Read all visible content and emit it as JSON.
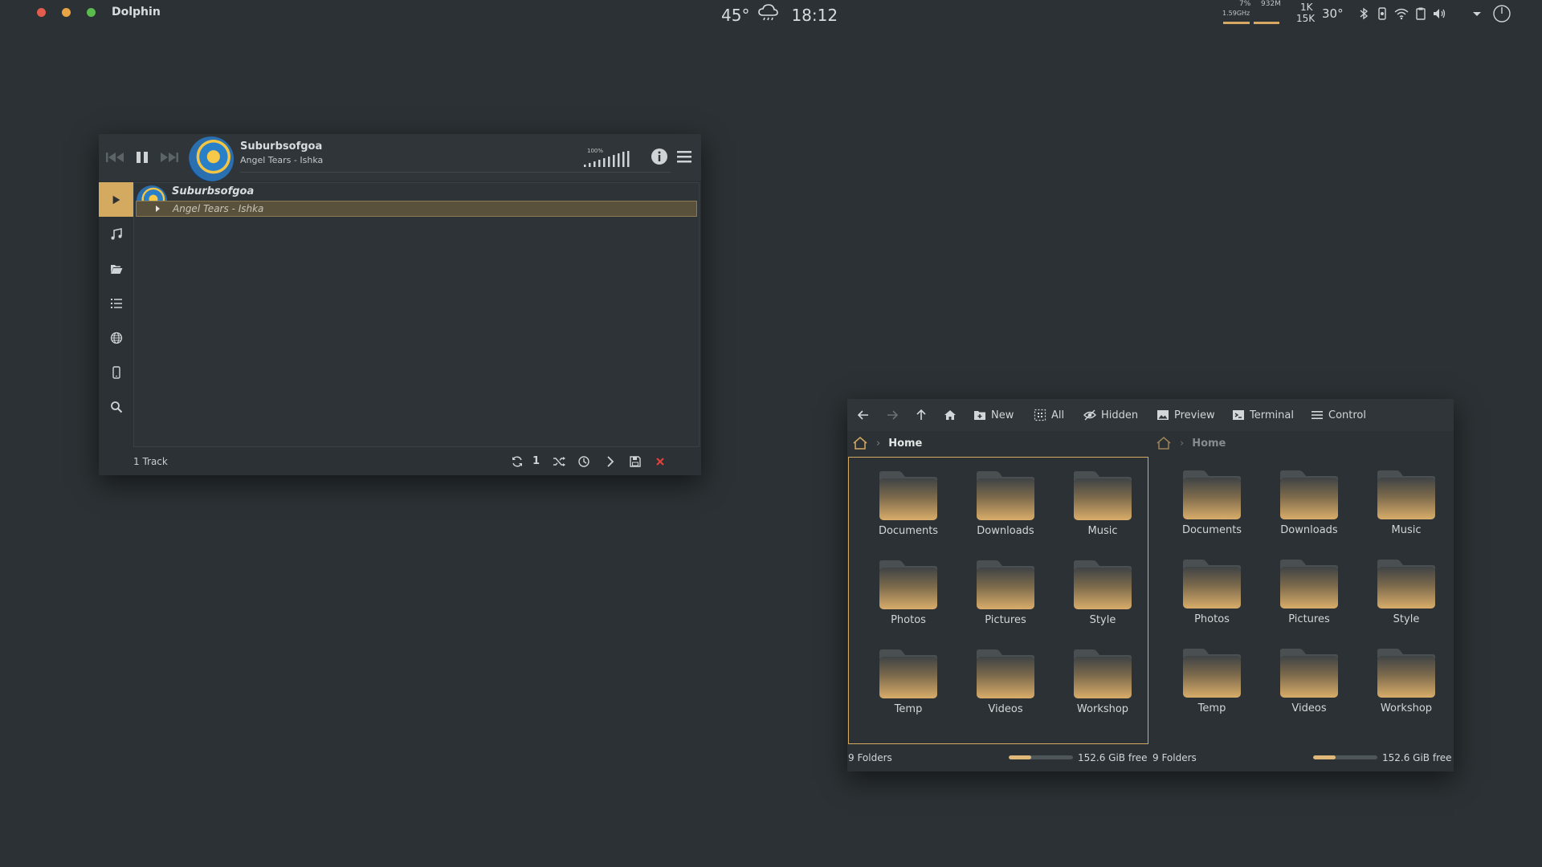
{
  "panel": {
    "app_name": "Dolphin",
    "weather_temp": "45°",
    "time": "18:12",
    "cpu_pct": "7%",
    "cpu_freq": "1.59GHz",
    "mem": "932M",
    "net_up": "1K",
    "net_down": "15K",
    "cpu_temp": "30°",
    "dot_colors": [
      "#e25d4d",
      "#e9a544",
      "#5cbb4d"
    ],
    "accent": "#d4a960"
  },
  "player": {
    "track_title": "Suburbsofgoa",
    "track_artist": "Angel Tears - Ishka",
    "volume_pct": "100%",
    "volume_level": 1.0,
    "playlist": [
      {
        "title": "Suburbsofgoa",
        "artist": "Angel Tears - Ishka"
      }
    ],
    "track_count": "1 Track",
    "repeat_one_label": "1"
  },
  "dolphin": {
    "toolbar": {
      "new_label": "New",
      "all_label": "All",
      "hidden_label": "Hidden",
      "preview_label": "Preview",
      "terminal_label": "Terminal",
      "control_label": "Control"
    },
    "left_pane": {
      "breadcrumb": "Home",
      "folders": [
        "Documents",
        "Downloads",
        "Music",
        "Photos",
        "Pictures",
        "Style",
        "Temp",
        "Videos",
        "Workshop"
      ],
      "status_count": "9 Folders",
      "free_space": "152.6 GiB free",
      "used_fraction": 0.35
    },
    "right_pane": {
      "breadcrumb": "Home",
      "folders": [
        "Documents",
        "Downloads",
        "Music",
        "Photos",
        "Pictures",
        "Style",
        "Temp",
        "Videos",
        "Workshop"
      ],
      "status_count": "9 Folders",
      "free_space": "152.6 GiB free",
      "used_fraction": 0.35
    }
  }
}
